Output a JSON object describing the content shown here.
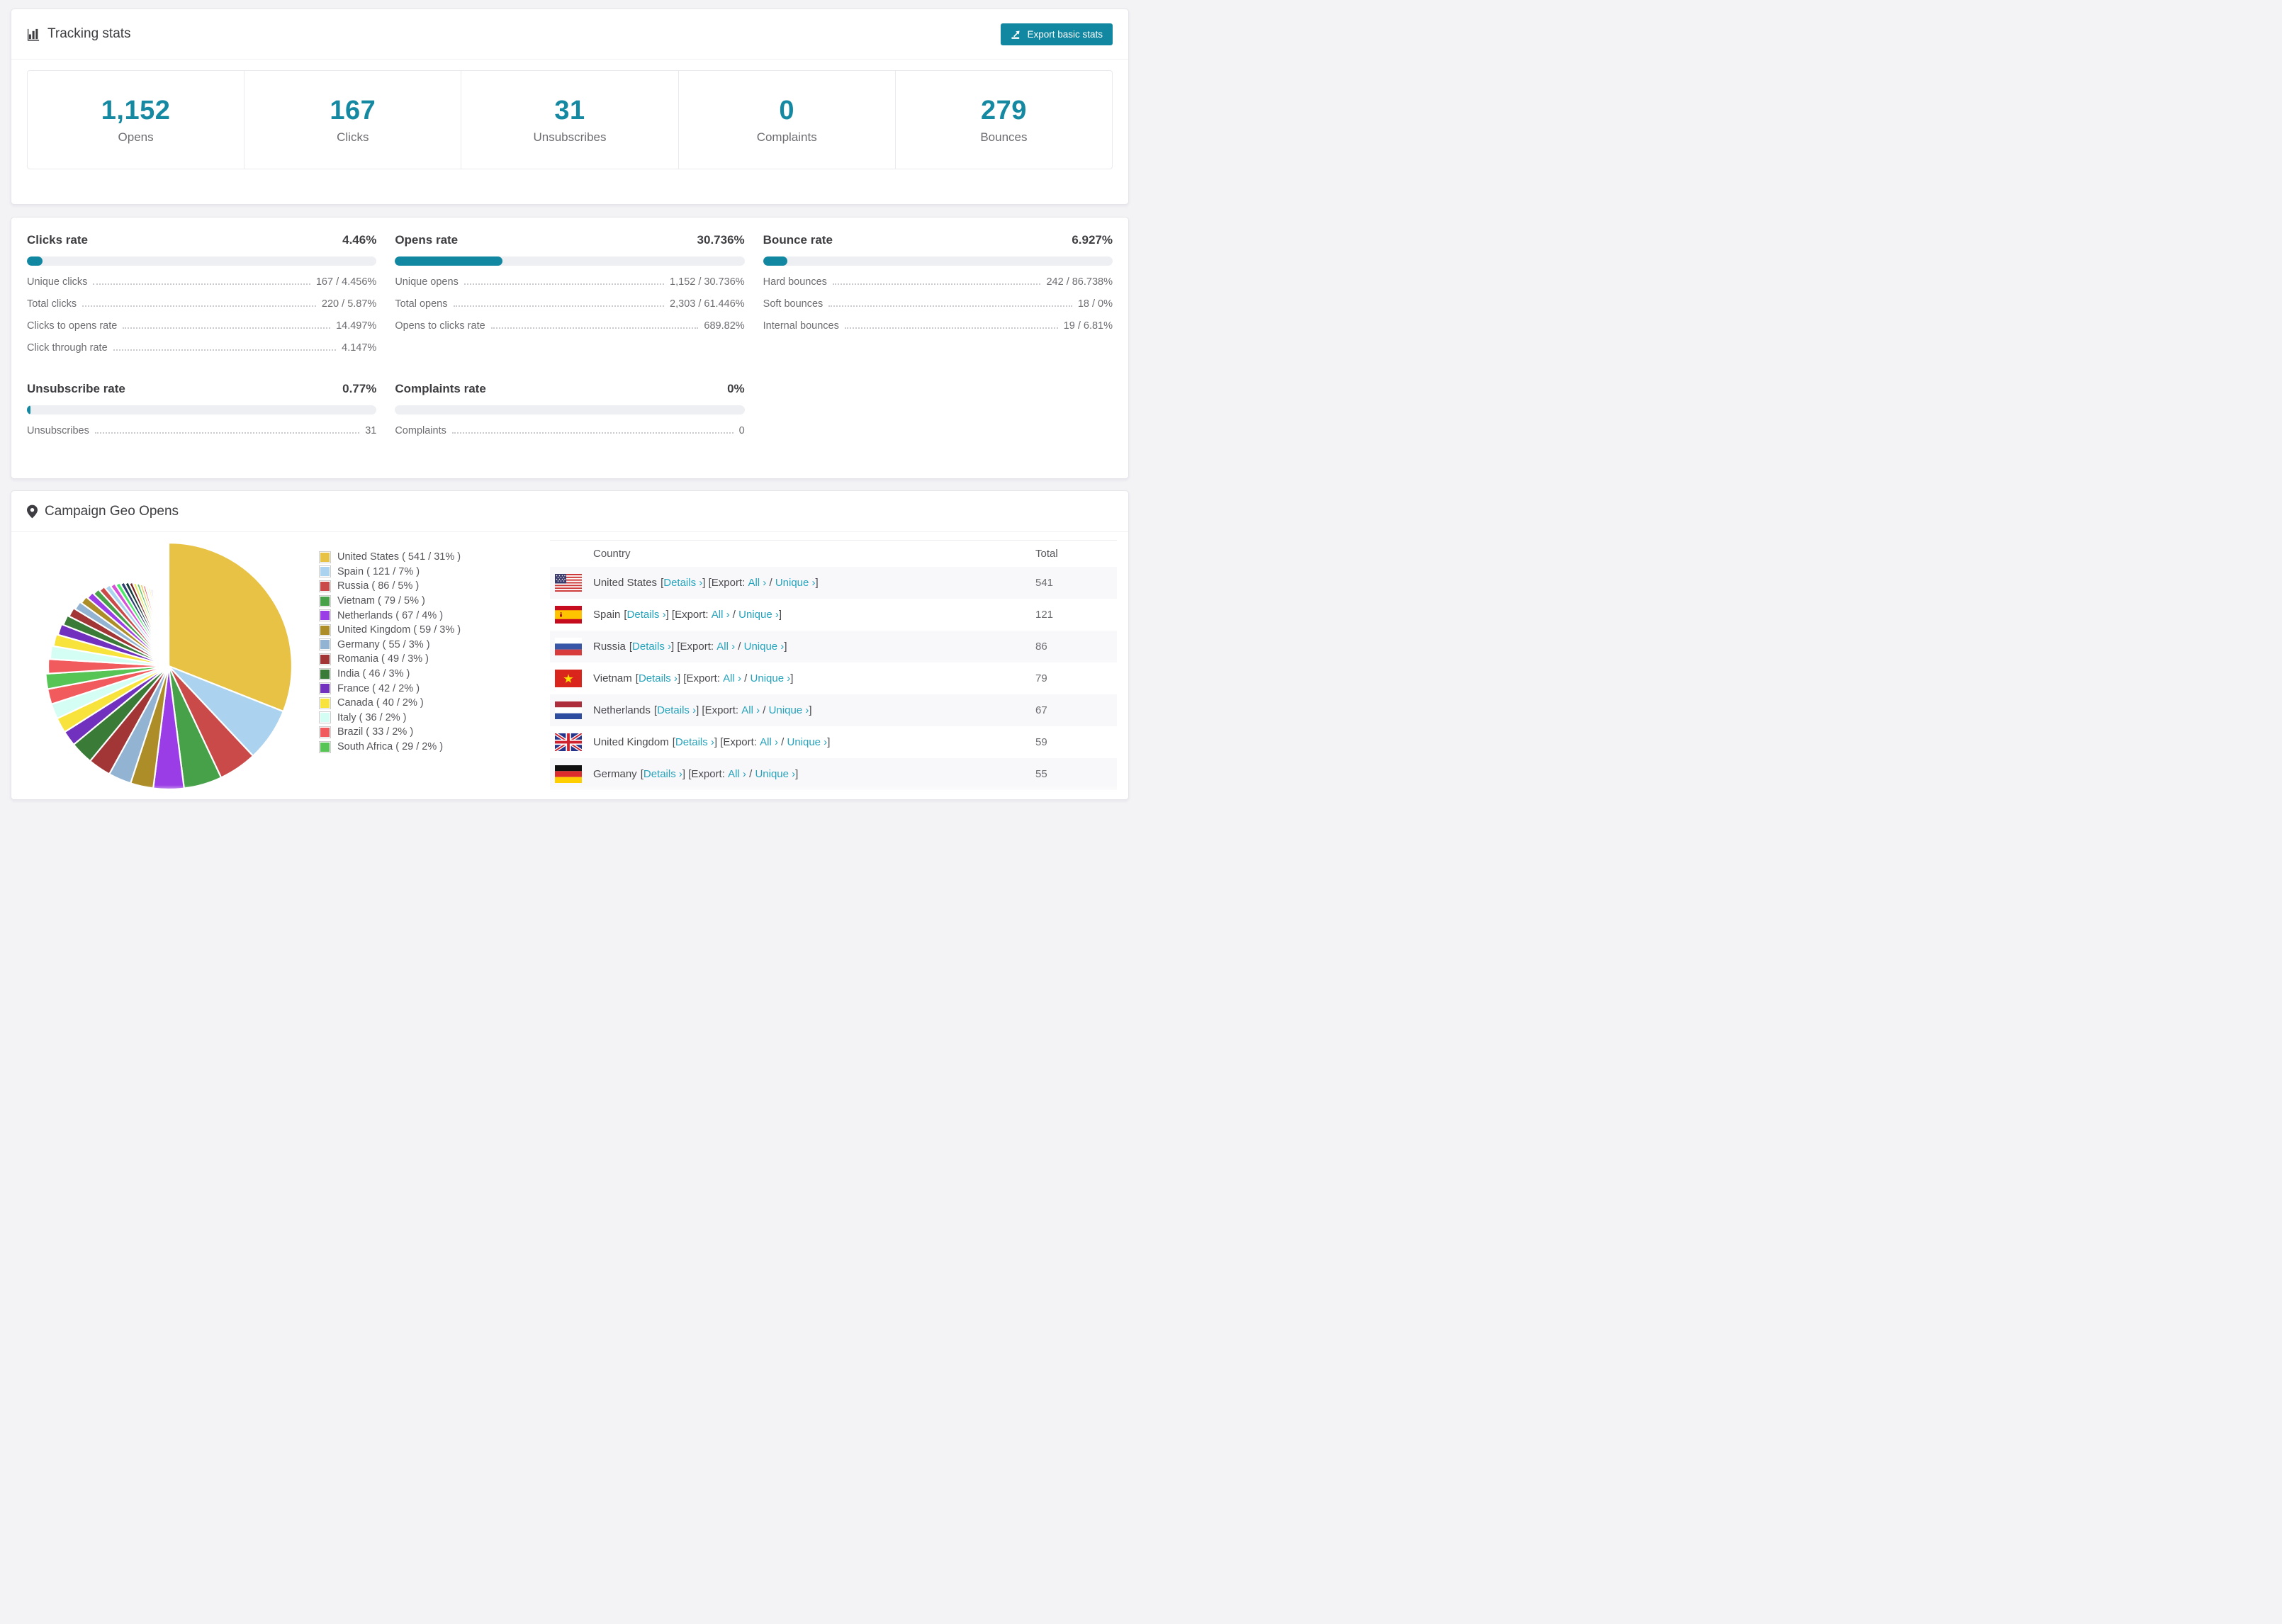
{
  "accent": "#1287a1",
  "link_color": "#25a3bc",
  "header": {
    "title": "Tracking stats",
    "export_button": "Export basic stats"
  },
  "summary_stats": [
    {
      "value": "1,152",
      "label": "Opens"
    },
    {
      "value": "167",
      "label": "Clicks"
    },
    {
      "value": "31",
      "label": "Unsubscribes"
    },
    {
      "value": "0",
      "label": "Complaints"
    },
    {
      "value": "279",
      "label": "Bounces"
    }
  ],
  "rate_blocks": [
    {
      "title": "Clicks rate",
      "value": "4.46%",
      "percent": 4.46,
      "rows": [
        {
          "label": "Unique clicks",
          "value": "167 / 4.456%"
        },
        {
          "label": "Total clicks",
          "value": "220 / 5.87%"
        },
        {
          "label": "Clicks to opens rate",
          "value": "14.497%"
        },
        {
          "label": "Click through rate",
          "value": "4.147%"
        }
      ]
    },
    {
      "title": "Opens rate",
      "value": "30.736%",
      "percent": 30.736,
      "rows": [
        {
          "label": "Unique opens",
          "value": "1,152 / 30.736%"
        },
        {
          "label": "Total opens",
          "value": "2,303 / 61.446%"
        },
        {
          "label": "Opens to clicks rate",
          "value": "689.82%"
        }
      ]
    },
    {
      "title": "Bounce rate",
      "value": "6.927%",
      "percent": 6.927,
      "rows": [
        {
          "label": "Hard bounces",
          "value": "242 / 86.738%"
        },
        {
          "label": "Soft bounces",
          "value": "18 / 0%"
        },
        {
          "label": "Internal bounces",
          "value": "19 / 6.81%"
        }
      ]
    },
    {
      "title": "Unsubscribe rate",
      "value": "0.77%",
      "percent": 0.77,
      "rows": [
        {
          "label": "Unsubscribes",
          "value": "31"
        }
      ]
    },
    {
      "title": "Complaints rate",
      "value": "0%",
      "percent": 0,
      "rows": [
        {
          "label": "Complaints",
          "value": "0"
        }
      ]
    }
  ],
  "geo": {
    "title": "Campaign Geo Opens",
    "chart_data": {
      "type": "pie",
      "title": "Campaign Geo Opens",
      "labels": [
        "United States",
        "Spain",
        "Russia",
        "Vietnam",
        "Netherlands",
        "United Kingdom",
        "Germany",
        "Romania",
        "India",
        "France",
        "Canada",
        "Italy",
        "Brazil",
        "South Africa"
      ],
      "values": [
        541,
        121,
        86,
        79,
        67,
        59,
        55,
        49,
        46,
        42,
        40,
        36,
        33,
        29
      ],
      "percents": [
        31,
        7,
        5,
        5,
        4,
        3,
        3,
        3,
        3,
        2,
        2,
        2,
        2,
        2
      ],
      "colors": [
        "#e8c244",
        "#abd3ef",
        "#ca4a4a",
        "#46a149",
        "#9a3de6",
        "#ad8d28",
        "#93b3d3",
        "#a23636",
        "#3a7c37",
        "#7130bd",
        "#f8e33c",
        "#d4fef4",
        "#f15b5e",
        "#57c556"
      ],
      "others_tail": {
        "percent": 26,
        "slices": 40
      },
      "tail_colors": [
        "#f15b5e",
        "#d4fef4",
        "#f8e33c",
        "#7130bd",
        "#3a7c37",
        "#a23636",
        "#93b3d3",
        "#ad8d28",
        "#9a3de6",
        "#46a149",
        "#ca4a4a",
        "#abd3ef",
        "#d84fd8",
        "#49e86b",
        "#2f3f72",
        "#123a3a",
        "#7a2020",
        "#e8e85a",
        "#57c556",
        "#e8c244"
      ],
      "legend_position": "right",
      "start_angle": "top",
      "direction": "clockwise"
    },
    "table": {
      "columns": [
        "Country",
        "Total"
      ],
      "details_label": "Details ›",
      "export_prefix": "[Export:",
      "all_label": "All ›",
      "separator": "/",
      "unique_label": "Unique ›",
      "rows": [
        {
          "flag": "us",
          "country": "United States",
          "total": "541"
        },
        {
          "flag": "es",
          "country": "Spain",
          "total": "121"
        },
        {
          "flag": "ru",
          "country": "Russia",
          "total": "86"
        },
        {
          "flag": "vn",
          "country": "Vietnam",
          "total": "79"
        },
        {
          "flag": "nl",
          "country": "Netherlands",
          "total": "67"
        },
        {
          "flag": "gb",
          "country": "United Kingdom",
          "total": "59"
        },
        {
          "flag": "de",
          "country": "Germany",
          "total": "55"
        }
      ]
    }
  }
}
